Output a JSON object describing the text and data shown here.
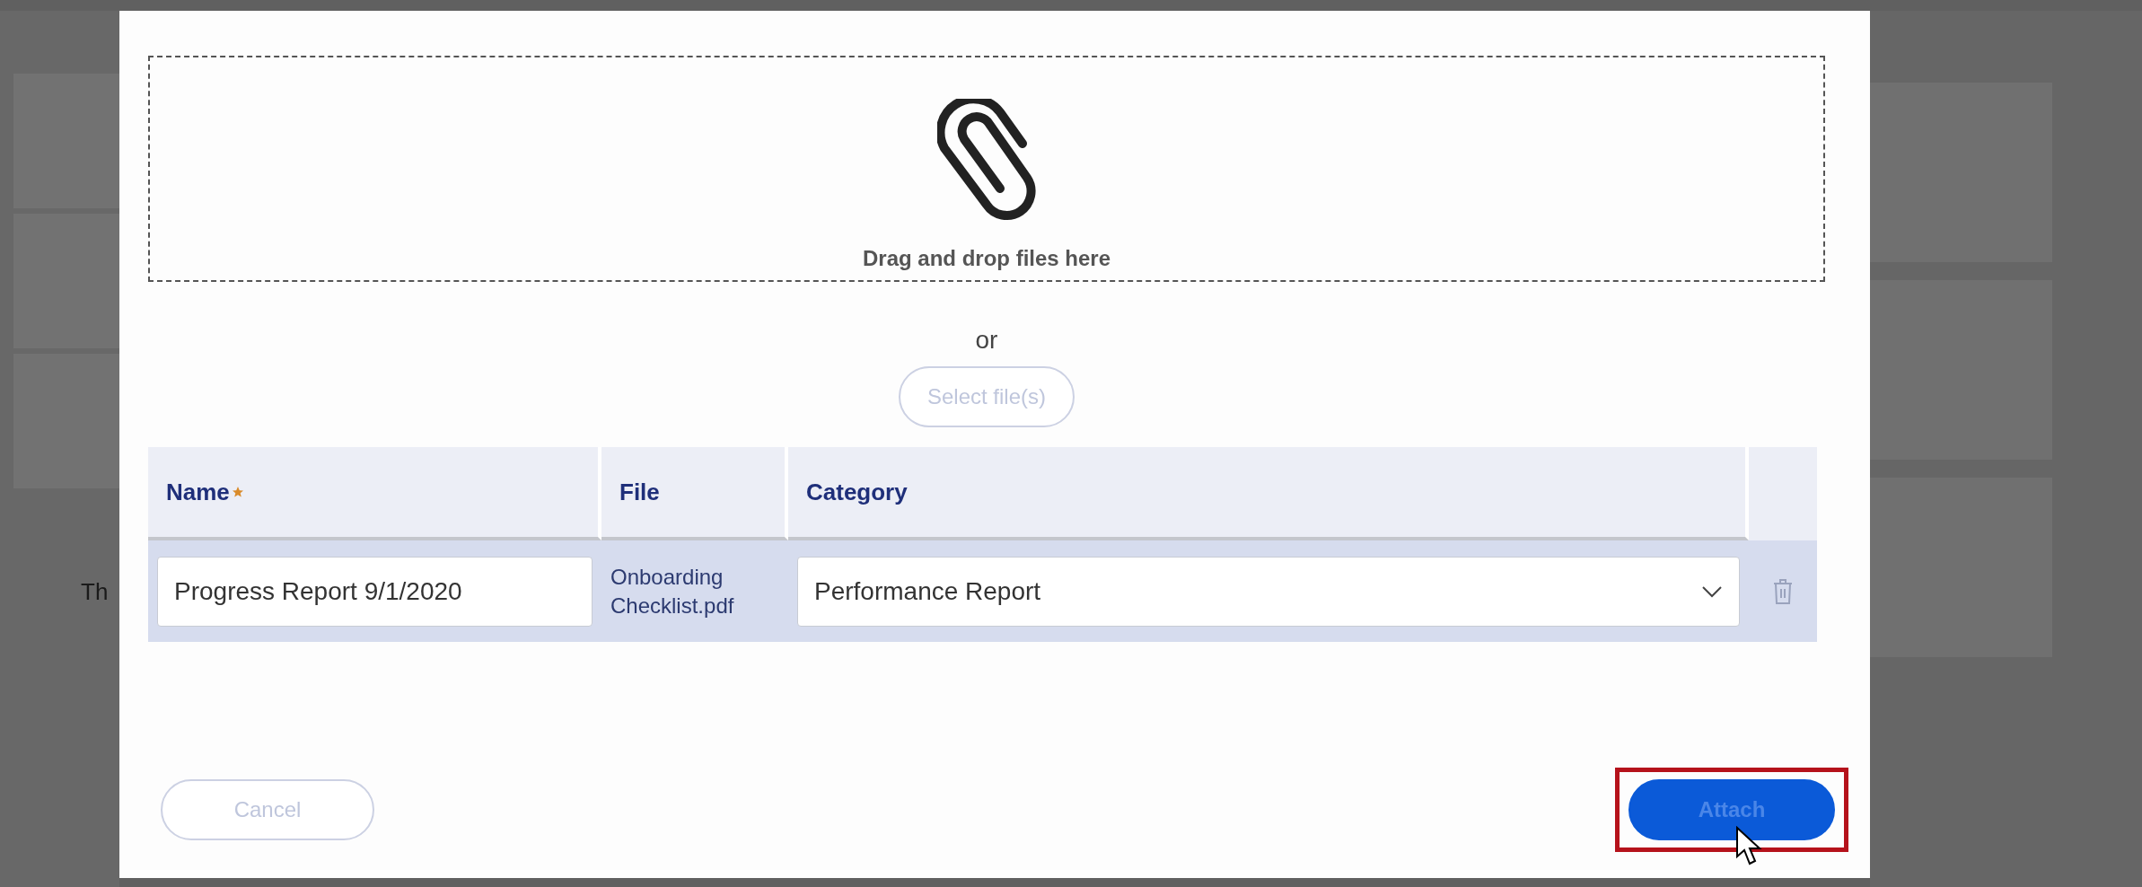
{
  "background": {
    "partial_text": "Th"
  },
  "dropzone": {
    "hint": "Drag and drop files here"
  },
  "separator": "or",
  "select_button": {
    "label": "Select file(s)",
    "disabled": true
  },
  "table": {
    "columns": [
      {
        "label": "Name",
        "required": true
      },
      {
        "label": "File",
        "required": false
      },
      {
        "label": "Category",
        "required": false
      }
    ],
    "rows": [
      {
        "name": "Progress Report 9/1/2020",
        "file": "Onboarding Checklist.pdf",
        "category": "Performance Report"
      }
    ]
  },
  "buttons": [
    {
      "label": "Cancel",
      "kind": "secondary",
      "disabled": true,
      "highlighted": false
    },
    {
      "label": "Attach",
      "kind": "primary",
      "disabled": true,
      "highlighted": true
    }
  ]
}
